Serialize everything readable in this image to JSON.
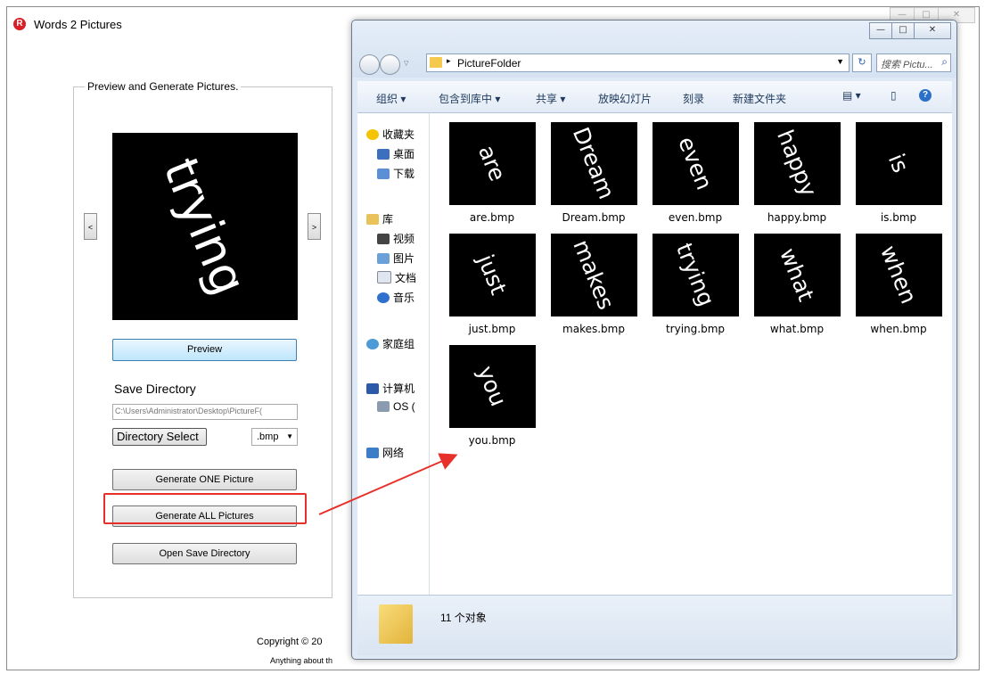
{
  "app": {
    "title": "Words 2 Pictures",
    "logo_letter": "R",
    "window_controls": {
      "minimize": "—",
      "maximize": "□",
      "close": "✕"
    },
    "group_title": "Preview and Generate Pictures.",
    "preview_word": "trying",
    "prev_label": "<",
    "next_label": ">",
    "preview_button": "Preview",
    "save_directory_label": "Save Directory",
    "directory_value": "C:\\Users\\Administrator\\Desktop\\PictureF(",
    "directory_select_button": "Directory Select",
    "format_select": ".bmp",
    "generate_one_button": "Generate ONE Picture",
    "generate_all_button": "Generate ALL Pictures",
    "open_save_dir_button": "Open Save Directory",
    "copyright": "Copyright © 20",
    "contact_text": "Anything about th",
    "highlight_color": "#e8302a"
  },
  "explorer": {
    "window_controls": {
      "minimize": "—",
      "maximize": "□",
      "close": "✕"
    },
    "address_path": "PictureFolder",
    "address_sep": "▸",
    "search_placeholder": "搜索 Pictu...",
    "toolbar": {
      "organize": "组织 ▾",
      "include_in_library": "包含到库中 ▾",
      "share": "共享 ▾",
      "slideshow": "放映幻灯片",
      "burn": "刻录",
      "new_folder": "新建文件夹",
      "view_icon": "▤ ▾",
      "pane_icon": "▯",
      "help_icon": "?"
    },
    "nav": {
      "favorites": "收藏夹",
      "desktop": "桌面",
      "downloads": "下载",
      "libraries": "库",
      "videos": "视频",
      "pictures": "图片",
      "documents": "文档",
      "music": "音乐",
      "homegroup": "家庭组",
      "computer": "计算机",
      "os_drive": "OS (",
      "network": "网络"
    },
    "files": [
      {
        "word": "are",
        "name": "are.bmp"
      },
      {
        "word": "Dream",
        "name": "Dream.bmp"
      },
      {
        "word": "even",
        "name": "even.bmp"
      },
      {
        "word": "happy",
        "name": "happy.bmp"
      },
      {
        "word": "is",
        "name": "is.bmp"
      },
      {
        "word": "just",
        "name": "just.bmp"
      },
      {
        "word": "makes",
        "name": "makes.bmp"
      },
      {
        "word": "trying",
        "name": "trying.bmp"
      },
      {
        "word": "what",
        "name": "what.bmp"
      },
      {
        "word": "when",
        "name": "when.bmp"
      },
      {
        "word": "you",
        "name": "you.bmp"
      }
    ],
    "item_count": "11 个对象"
  }
}
